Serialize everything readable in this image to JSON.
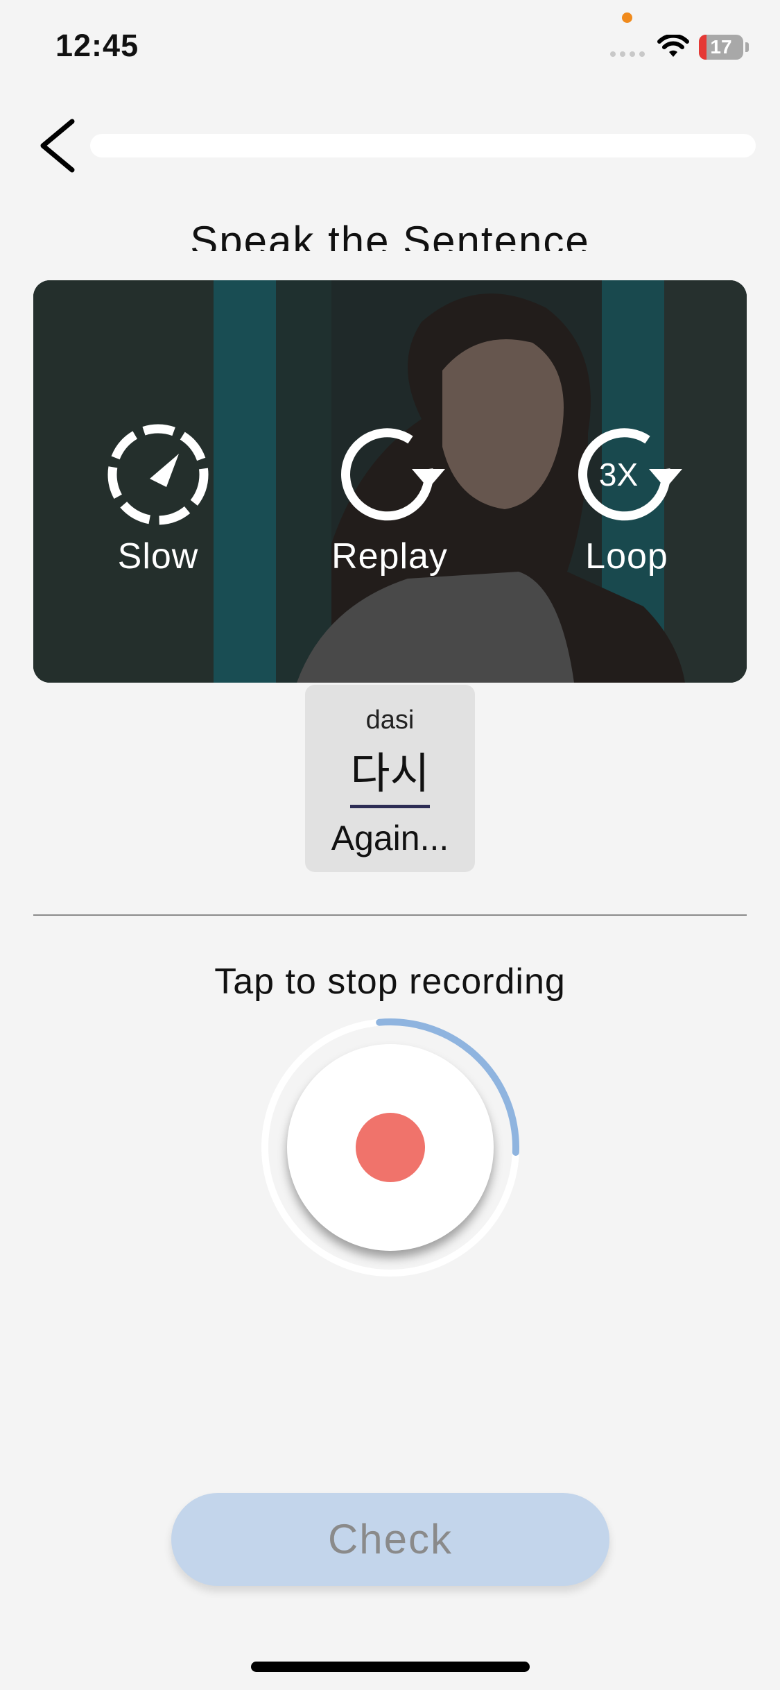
{
  "status_bar": {
    "time": "12:45",
    "battery_level": "17",
    "battery_fraction": 0.17
  },
  "header": {
    "back_icon": "chevron-left-icon",
    "progress_fraction": 0.0
  },
  "lesson": {
    "title": "Speak the Sentence"
  },
  "video": {
    "controls": [
      {
        "label": "Slow",
        "icon": "slow-speed-icon"
      },
      {
        "label": "Replay",
        "icon": "replay-icon"
      },
      {
        "label": "Loop",
        "icon": "loop-3x-icon",
        "badge": "3X"
      }
    ]
  },
  "word": {
    "romanization": "dasi",
    "hangul": "다시",
    "meaning": "Again..."
  },
  "recording": {
    "hint": "Tap to stop recording",
    "progress_fraction": 0.27,
    "accent_color": "#8fb4df",
    "dot_color": "#f0736b"
  },
  "actions": {
    "check_label": "Check",
    "check_color": "#c3d5eb"
  }
}
